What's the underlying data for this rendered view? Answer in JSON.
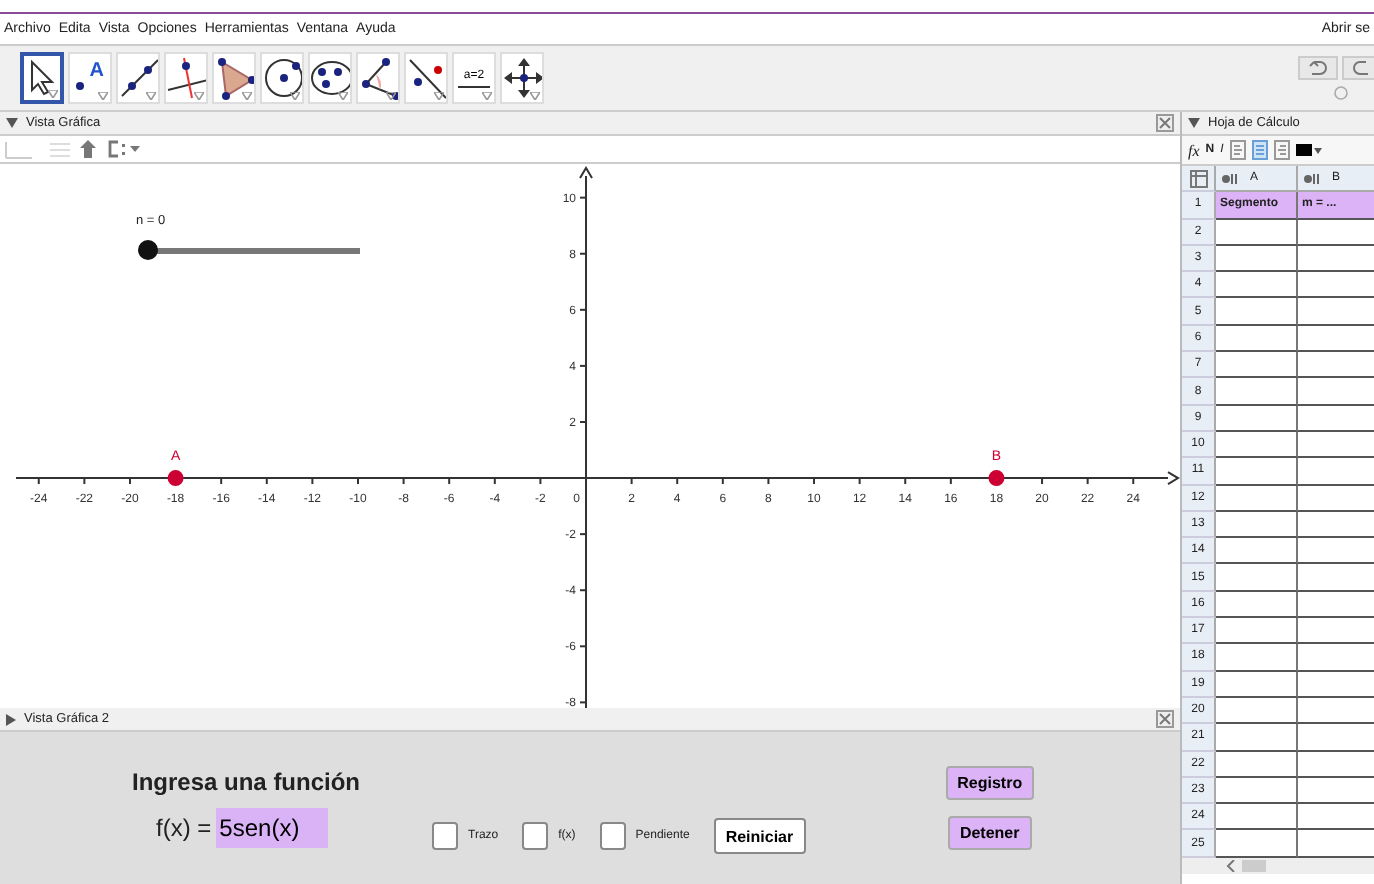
{
  "menu": [
    "Archivo",
    "Edita",
    "Vista",
    "Opciones",
    "Herramientas",
    "Ventana",
    "Ayuda"
  ],
  "menu_right": "Abrir se",
  "tools": [
    {
      "kind": "move",
      "selected": true
    },
    {
      "kind": "point",
      "label": "A",
      "selected": false
    },
    {
      "kind": "line",
      "selected": false
    },
    {
      "kind": "perpendicular",
      "selected": false
    },
    {
      "kind": "polygon",
      "selected": false
    },
    {
      "kind": "circle",
      "selected": false
    },
    {
      "kind": "ellipse",
      "selected": false
    },
    {
      "kind": "angle",
      "selected": false
    },
    {
      "kind": "reflect",
      "selected": false
    },
    {
      "kind": "slider",
      "label": "a=2",
      "selected": false
    },
    {
      "kind": "pan",
      "selected": false
    }
  ],
  "graphics_view": {
    "title": "Vista Gráfica",
    "origin_label": "0",
    "slider": {
      "label": "n = 0",
      "level": 0
    },
    "chart_data": {
      "type": "scatter",
      "x": [
        -18,
        18
      ],
      "series": [
        {
          "color": "#cc0033",
          "values": [
            0,
            0
          ]
        }
      ],
      "xlim": [
        -25.7,
        26.05
      ],
      "ylim": [
        -8.2,
        11.2
      ],
      "xticks": [
        -24,
        -22,
        -20,
        -18,
        -16,
        -14,
        -12,
        -10,
        -8,
        -6,
        -4,
        -2,
        2,
        4,
        6,
        8,
        10,
        12,
        14,
        16,
        18,
        20,
        22,
        24
      ],
      "yticks": [
        -8,
        -6,
        -4,
        -2,
        2,
        4,
        6,
        8,
        10
      ],
      "annotations": [
        {
          "text": "A",
          "x": -18,
          "y": 0
        },
        {
          "text": "B",
          "x": 18,
          "y": 0
        }
      ]
    }
  },
  "graphics_view_2": {
    "title": "Vista Gráfica 2",
    "heading": "Ingresa una función",
    "input_label": "f(x) =",
    "input_value": "5sen(x)",
    "checkboxes": [
      {
        "label": "Trazo",
        "checked": false
      },
      {
        "label": "f(x)",
        "checked": false
      },
      {
        "label": "Pendiente",
        "checked": false
      }
    ],
    "reset_button": "Reiniciar",
    "buttons": [
      "Registro",
      "Detener"
    ]
  },
  "spreadsheet": {
    "title": "Hoja de Cálculo",
    "style_bar": {
      "fx": "fx",
      "bold": "N",
      "italic": "I"
    },
    "columns": [
      "A",
      "B"
    ],
    "rows": [
      {
        "header": "1",
        "cells": [
          "Segmento",
          "m = ..."
        ]
      },
      {
        "header": "2",
        "cells": [
          "",
          ""
        ]
      },
      {
        "header": "3",
        "cells": [
          "",
          ""
        ]
      },
      {
        "header": "4",
        "cells": [
          "",
          ""
        ]
      },
      {
        "header": "5",
        "cells": [
          "",
          ""
        ]
      },
      {
        "header": "6",
        "cells": [
          "",
          ""
        ]
      },
      {
        "header": "7",
        "cells": [
          "",
          ""
        ]
      },
      {
        "header": "8",
        "cells": [
          "",
          ""
        ]
      },
      {
        "header": "9",
        "cells": [
          "",
          ""
        ]
      },
      {
        "header": "10",
        "cells": [
          "",
          ""
        ]
      },
      {
        "header": "11",
        "cells": [
          "",
          ""
        ]
      },
      {
        "header": "12",
        "cells": [
          "",
          ""
        ]
      },
      {
        "header": "13",
        "cells": [
          "",
          ""
        ]
      },
      {
        "header": "14",
        "cells": [
          "",
          ""
        ]
      },
      {
        "header": "15",
        "cells": [
          "",
          ""
        ]
      },
      {
        "header": "16",
        "cells": [
          "",
          ""
        ]
      },
      {
        "header": "17",
        "cells": [
          "",
          ""
        ]
      },
      {
        "header": "18",
        "cells": [
          "",
          ""
        ]
      },
      {
        "header": "19",
        "cells": [
          "",
          ""
        ]
      },
      {
        "header": "20",
        "cells": [
          "",
          ""
        ]
      },
      {
        "header": "21",
        "cells": [
          "",
          ""
        ]
      },
      {
        "header": "22",
        "cells": [
          "",
          ""
        ]
      },
      {
        "header": "23",
        "cells": [
          "",
          ""
        ]
      },
      {
        "header": "24",
        "cells": [
          "",
          ""
        ]
      },
      {
        "header": "25",
        "cells": [
          "",
          ""
        ]
      }
    ]
  }
}
